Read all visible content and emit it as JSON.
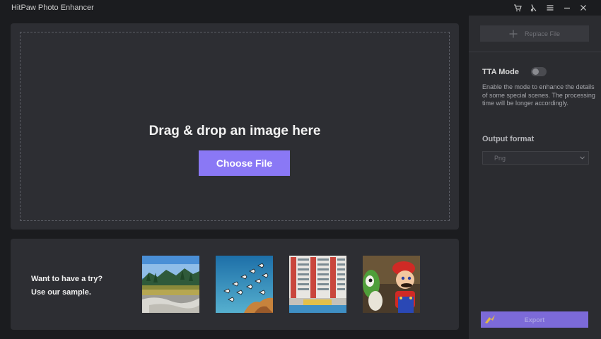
{
  "app": {
    "title": "HitPaw Photo Enhancer"
  },
  "titlebar": {
    "icons": [
      "cart-icon",
      "key-icon",
      "menu-icon",
      "minimize-icon",
      "close-icon"
    ]
  },
  "main": {
    "drop_title": "Drag & drop an image here",
    "choose_file_label": "Choose File"
  },
  "samples": {
    "prompt_line1": "Want to have a try?",
    "prompt_line2": "Use our sample.",
    "items": [
      "landscape-sample",
      "fish-sample",
      "building-sample",
      "toys-sample"
    ]
  },
  "sidebar": {
    "replace_file_label": "Replace File",
    "tta_mode_label": "TTA Mode",
    "tta_mode_enabled": false,
    "tta_description": "Enable the mode to enhance the details of some special scenes. The processing time will be longer accordingly.",
    "output_format_label": "Output format",
    "output_format_value": "Png",
    "export_label": "Export"
  },
  "colors": {
    "accent": "#8a78f5",
    "panel": "#2d2e33",
    "background": "#1b1c1f"
  }
}
